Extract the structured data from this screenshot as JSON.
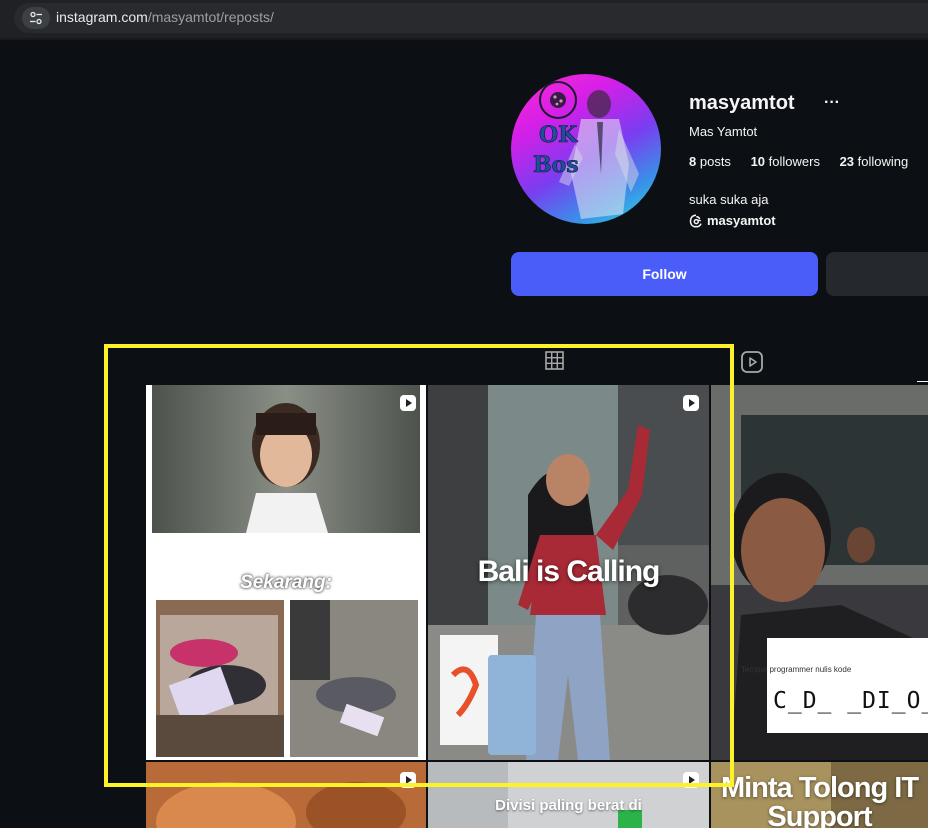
{
  "browser": {
    "url_host": "instagram.com",
    "url_path": "/masyamtot/reposts/",
    "site_settings_icon": "tune-icon"
  },
  "profile": {
    "username": "masyamtot",
    "more_icon": "···",
    "full_name": "Mas Yamtot",
    "avatar_text_line1": "OK",
    "avatar_text_line2": "Bos",
    "stats": {
      "posts_count": "8",
      "posts_label": "posts",
      "followers_count": "10",
      "followers_label": "followers",
      "following_count": "23",
      "following_label": "following"
    },
    "bio": "suka suka aja",
    "threads_handle": "masyamtot",
    "follow_label": "Follow"
  },
  "tabs": {
    "posts_icon": "grid-icon",
    "reels_icon": "reels-icon"
  },
  "grid": {
    "tiles": [
      {
        "caption": "Sekarang:",
        "is_reel": true
      },
      {
        "caption": "Bali is Calling",
        "is_reel": true
      },
      {
        "caption_small": "Tempat programmer nulis kode",
        "caption_code": "C_D_ _DI_O_",
        "is_reel": false
      },
      {
        "caption": "",
        "is_reel": true
      },
      {
        "caption": "Divisi paling berat di",
        "is_reel": true
      },
      {
        "caption": "Minta Tolong IT Support",
        "is_reel": false
      }
    ]
  },
  "colors": {
    "background": "#0c1014",
    "follow_button": "#4a5df9",
    "highlight": "#fbf22a"
  }
}
